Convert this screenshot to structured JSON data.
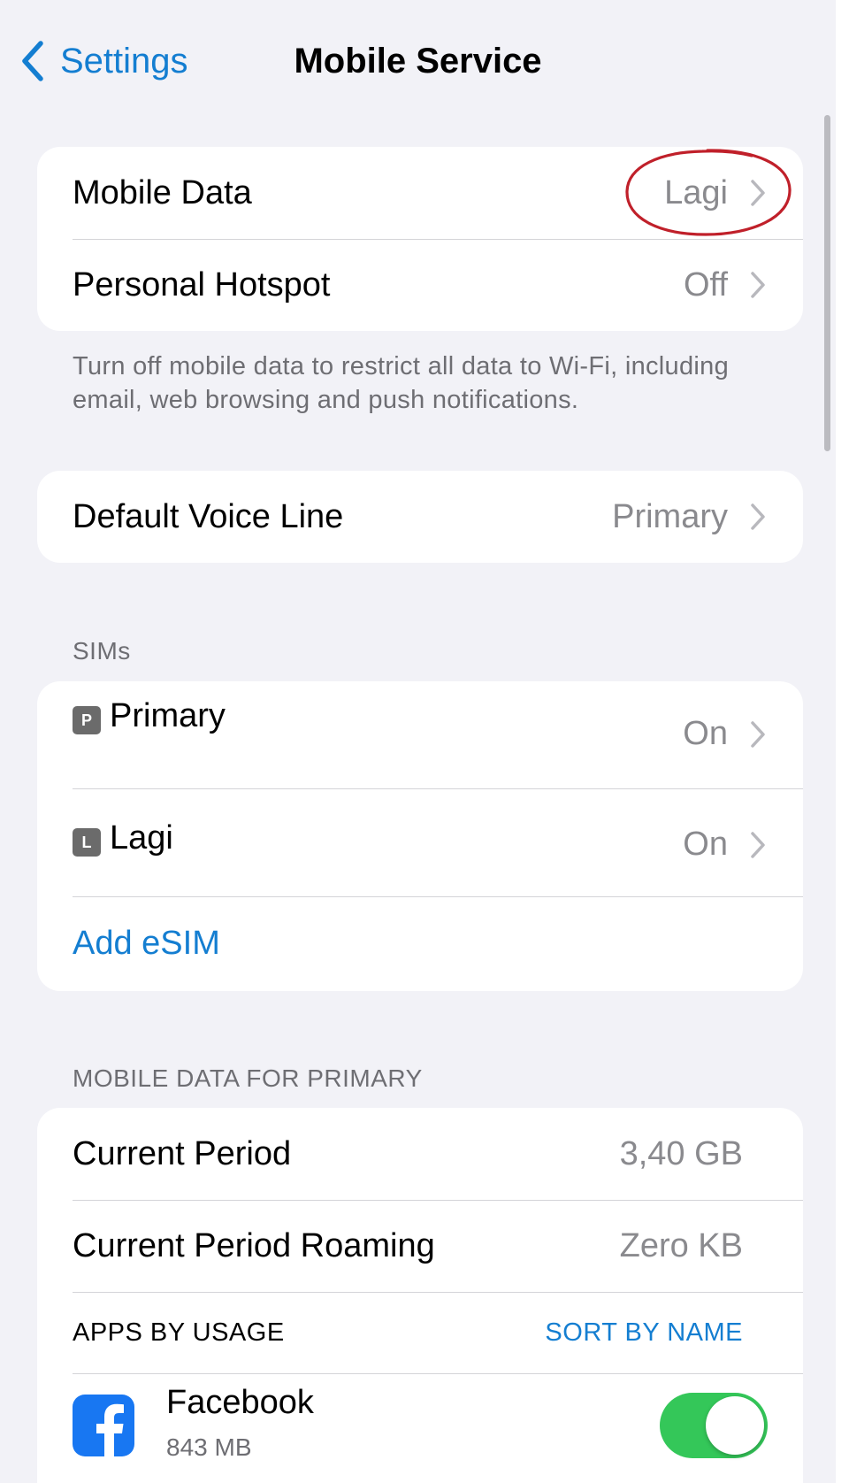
{
  "nav": {
    "back_label": "Settings",
    "title": "Mobile Service"
  },
  "main_group": [
    {
      "label": "Mobile Data",
      "value": "Lagi"
    },
    {
      "label": "Personal Hotspot",
      "value": "Off"
    }
  ],
  "main_footnote": "Turn off mobile data to restrict all data to Wi-Fi, including email, web browsing and push notifications.",
  "voice_line": {
    "label": "Default Voice Line",
    "value": "Primary"
  },
  "sims": {
    "header": "SIMs",
    "items": [
      {
        "badge": "P",
        "label": "Primary",
        "value": "On"
      },
      {
        "badge": "L",
        "label": "Lagi",
        "value": "On"
      }
    ],
    "add_label": "Add eSIM"
  },
  "usage": {
    "header": "MOBILE DATA FOR PRIMARY",
    "current_period": {
      "label": "Current Period",
      "value": "3,40 GB"
    },
    "roaming": {
      "label": "Current Period Roaming",
      "value": "Zero KB"
    },
    "apps_header": "APPS BY USAGE",
    "sort_label": "SORT BY NAME",
    "apps": [
      {
        "name": "Facebook",
        "size": "843 MB",
        "enabled": true,
        "icon": "facebook-icon"
      }
    ]
  },
  "colors": {
    "accent": "#147ed1",
    "background": "#f2f2f7",
    "toggle_on": "#34c759",
    "annotation": "#c0202a",
    "facebook": "#1877f2"
  }
}
